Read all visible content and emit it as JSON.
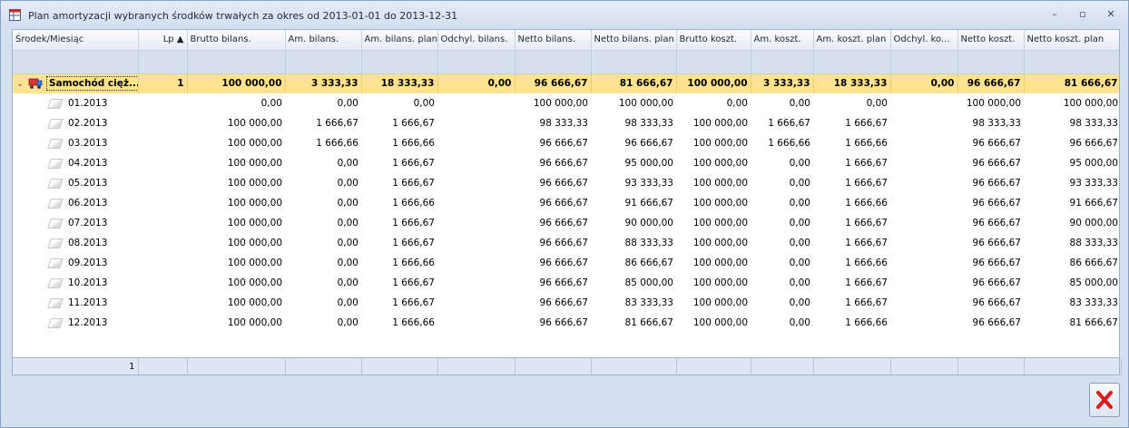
{
  "window": {
    "title": "Plan amortyzacji wybranych środków trwałych za okres od 2013-01-01 do 2013-12-31",
    "minimize": "–",
    "restore": "▫",
    "close": "✕"
  },
  "columns": [
    "Środek/Miesiąc",
    "Lp ▲",
    "Brutto bilans.",
    "Am. bilans.",
    "Am. bilans. plan",
    "Odchyl. bilans.",
    "Netto bilans.",
    "Netto bilans. plan",
    "Brutto koszt.",
    "Am. koszt.",
    "Am. koszt. plan",
    "Odchyl. ko...",
    "Netto koszt.",
    "Netto koszt. plan"
  ],
  "group": {
    "expander": "⌄",
    "name": "Samochód cięż...",
    "lp": "1",
    "cells": [
      "100 000,00",
      "3 333,33",
      "18 333,33",
      "0,00",
      "96 666,67",
      "81 666,67",
      "100 000,00",
      "3 333,33",
      "18 333,33",
      "0,00",
      "96 666,67",
      "81 666,67"
    ]
  },
  "rows": [
    {
      "month": "01.2013",
      "cells": [
        "0,00",
        "0,00",
        "0,00",
        "",
        "100 000,00",
        "100 000,00",
        "0,00",
        "0,00",
        "0,00",
        "",
        "100 000,00",
        "100 000,00"
      ]
    },
    {
      "month": "02.2013",
      "cells": [
        "100 000,00",
        "1 666,67",
        "1 666,67",
        "",
        "98 333,33",
        "98 333,33",
        "100 000,00",
        "1 666,67",
        "1 666,67",
        "",
        "98 333,33",
        "98 333,33"
      ]
    },
    {
      "month": "03.2013",
      "cells": [
        "100 000,00",
        "1 666,66",
        "1 666,66",
        "",
        "96 666,67",
        "96 666,67",
        "100 000,00",
        "1 666,66",
        "1 666,66",
        "",
        "96 666,67",
        "96 666,67"
      ]
    },
    {
      "month": "04.2013",
      "cells": [
        "100 000,00",
        "0,00",
        "1 666,67",
        "",
        "96 666,67",
        "95 000,00",
        "100 000,00",
        "0,00",
        "1 666,67",
        "",
        "96 666,67",
        "95 000,00"
      ]
    },
    {
      "month": "05.2013",
      "cells": [
        "100 000,00",
        "0,00",
        "1 666,67",
        "",
        "96 666,67",
        "93 333,33",
        "100 000,00",
        "0,00",
        "1 666,67",
        "",
        "96 666,67",
        "93 333,33"
      ]
    },
    {
      "month": "06.2013",
      "cells": [
        "100 000,00",
        "0,00",
        "1 666,66",
        "",
        "96 666,67",
        "91 666,67",
        "100 000,00",
        "0,00",
        "1 666,66",
        "",
        "96 666,67",
        "91 666,67"
      ]
    },
    {
      "month": "07.2013",
      "cells": [
        "100 000,00",
        "0,00",
        "1 666,67",
        "",
        "96 666,67",
        "90 000,00",
        "100 000,00",
        "0,00",
        "1 666,67",
        "",
        "96 666,67",
        "90 000,00"
      ]
    },
    {
      "month": "08.2013",
      "cells": [
        "100 000,00",
        "0,00",
        "1 666,67",
        "",
        "96 666,67",
        "88 333,33",
        "100 000,00",
        "0,00",
        "1 666,67",
        "",
        "96 666,67",
        "88 333,33"
      ]
    },
    {
      "month": "09.2013",
      "cells": [
        "100 000,00",
        "0,00",
        "1 666,66",
        "",
        "96 666,67",
        "86 666,67",
        "100 000,00",
        "0,00",
        "1 666,66",
        "",
        "96 666,67",
        "86 666,67"
      ]
    },
    {
      "month": "10.2013",
      "cells": [
        "100 000,00",
        "0,00",
        "1 666,67",
        "",
        "96 666,67",
        "85 000,00",
        "100 000,00",
        "0,00",
        "1 666,67",
        "",
        "96 666,67",
        "85 000,00"
      ]
    },
    {
      "month": "11.2013",
      "cells": [
        "100 000,00",
        "0,00",
        "1 666,67",
        "",
        "96 666,67",
        "83 333,33",
        "100 000,00",
        "0,00",
        "1 666,67",
        "",
        "96 666,67",
        "83 333,33"
      ]
    },
    {
      "month": "12.2013",
      "cells": [
        "100 000,00",
        "0,00",
        "1 666,66",
        "",
        "96 666,67",
        "81 666,67",
        "100 000,00",
        "0,00",
        "1 666,66",
        "",
        "96 666,67",
        "81 666,67"
      ]
    }
  ],
  "footer": {
    "count": "1"
  },
  "icons": {
    "app": "table-icon",
    "asset": "car-icon",
    "row": "document-icon",
    "close_button": "red-x-icon"
  },
  "colors": {
    "group_row": "#fde28f",
    "close_x": "#d91c1c"
  }
}
